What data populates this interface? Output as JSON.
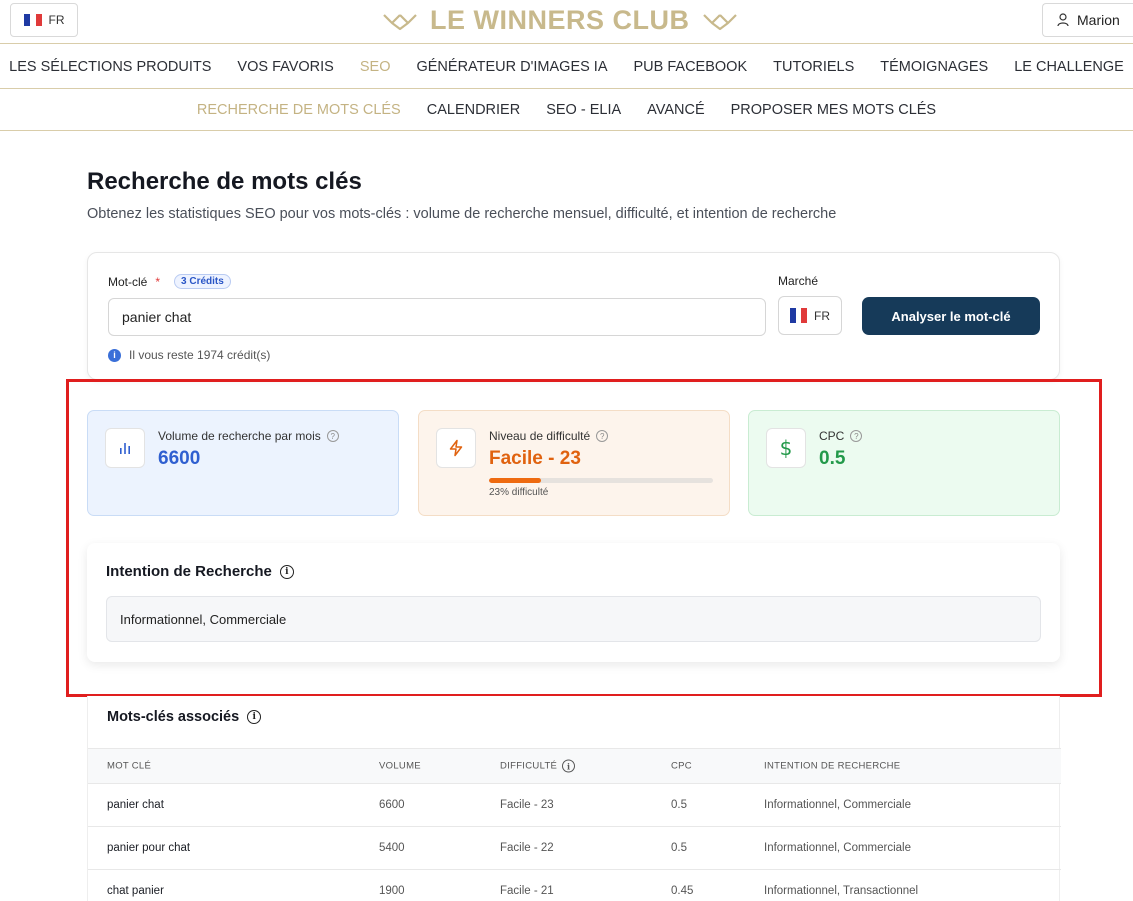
{
  "header": {
    "lang": "FR",
    "logo_text": "LE WINNERS CLUB",
    "user_name": "Marion"
  },
  "main_nav": [
    {
      "label": "LES SÉLECTIONS PRODUITS",
      "active": false
    },
    {
      "label": "VOS FAVORIS",
      "active": false
    },
    {
      "label": "SEO",
      "active": true
    },
    {
      "label": "GÉNÉRATEUR D'IMAGES IA",
      "active": false
    },
    {
      "label": "PUB FACEBOOK",
      "active": false
    },
    {
      "label": "TUTORIELS",
      "active": false
    },
    {
      "label": "TÉMOIGNAGES",
      "active": false
    },
    {
      "label": "LE CHALLENGE",
      "active": false
    }
  ],
  "sub_nav": [
    {
      "label": "RECHERCHE DE MOTS CLÉS",
      "active": true
    },
    {
      "label": "CALENDRIER",
      "active": false
    },
    {
      "label": "SEO - ELIA",
      "active": false
    },
    {
      "label": "AVANCÉ",
      "active": false
    },
    {
      "label": "PROPOSER MES MOTS CLÉS",
      "active": false
    }
  ],
  "page": {
    "title": "Recherche de mots clés",
    "subtitle": "Obtenez les statistiques SEO pour vos mots-clés : volume de recherche mensuel, difficulté, et intention de recherche"
  },
  "search": {
    "keyword_label": "Mot-clé",
    "required_mark": "*",
    "credits_badge": "3 Crédits",
    "keyword_value": "panier chat",
    "credits_note": "Il vous reste 1974 crédit(s)",
    "market_label": "Marché",
    "market_value": "FR",
    "analyze_label": "Analyser le mot-clé"
  },
  "metrics": {
    "volume": {
      "label": "Volume de recherche par mois",
      "value": "6600"
    },
    "difficulty": {
      "label": "Niveau de difficulté",
      "value": "Facile - 23",
      "percent": 23,
      "caption": "23% difficulté"
    },
    "cpc": {
      "label": "CPC",
      "value": "0.5"
    }
  },
  "intent": {
    "title": "Intention de Recherche",
    "value": "Informationnel, Commerciale"
  },
  "related": {
    "title": "Mots-clés associés",
    "columns": [
      "MOT CLÉ",
      "VOLUME",
      "DIFFICULTÉ",
      "CPC",
      "INTENTION DE RECHERCHE"
    ],
    "rows": [
      {
        "keyword": "panier chat",
        "volume": "6600",
        "difficulty": "Facile - 23",
        "cpc": "0.5",
        "intent": "Informationnel, Commerciale"
      },
      {
        "keyword": "panier pour chat",
        "volume": "5400",
        "difficulty": "Facile - 22",
        "cpc": "0.5",
        "intent": "Informationnel, Commerciale"
      },
      {
        "keyword": "chat panier",
        "volume": "1900",
        "difficulty": "Facile - 21",
        "cpc": "0.45",
        "intent": "Informationnel, Transactionnel"
      }
    ]
  },
  "colors": {
    "gold": "#c4b383",
    "navy_button": "#163a59",
    "highlight_red": "#e01e1e",
    "volume_blue": "#2f5fd0",
    "difficulty_orange": "#e0620f",
    "cpc_green": "#23994a"
  }
}
